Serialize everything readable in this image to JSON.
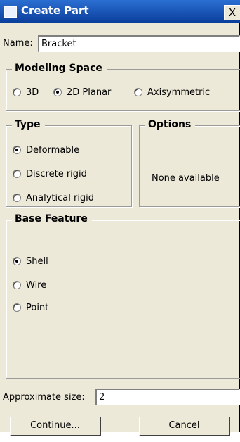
{
  "dialog": {
    "title": "Create Part",
    "close_glyph": "X"
  },
  "name": {
    "label": "Name:",
    "value": "Bracket"
  },
  "modeling_space": {
    "legend": "Modeling Space",
    "options": [
      {
        "label": "3D",
        "selected": false
      },
      {
        "label": "2D Planar",
        "selected": true
      },
      {
        "label": "Axisymmetric",
        "selected": false
      }
    ]
  },
  "type": {
    "legend": "Type",
    "options": [
      {
        "label": "Deformable",
        "selected": true
      },
      {
        "label": "Discrete rigid",
        "selected": false
      },
      {
        "label": "Analytical rigid",
        "selected": false
      }
    ]
  },
  "options": {
    "legend": "Options",
    "text": "None available"
  },
  "base_feature": {
    "legend": "Base Feature",
    "options": [
      {
        "label": "Shell",
        "selected": true
      },
      {
        "label": "Wire",
        "selected": false
      },
      {
        "label": "Point",
        "selected": false
      }
    ]
  },
  "approx_size": {
    "label": "Approximate size:",
    "value": "2"
  },
  "buttons": {
    "continue": "Continue...",
    "cancel": "Cancel"
  }
}
